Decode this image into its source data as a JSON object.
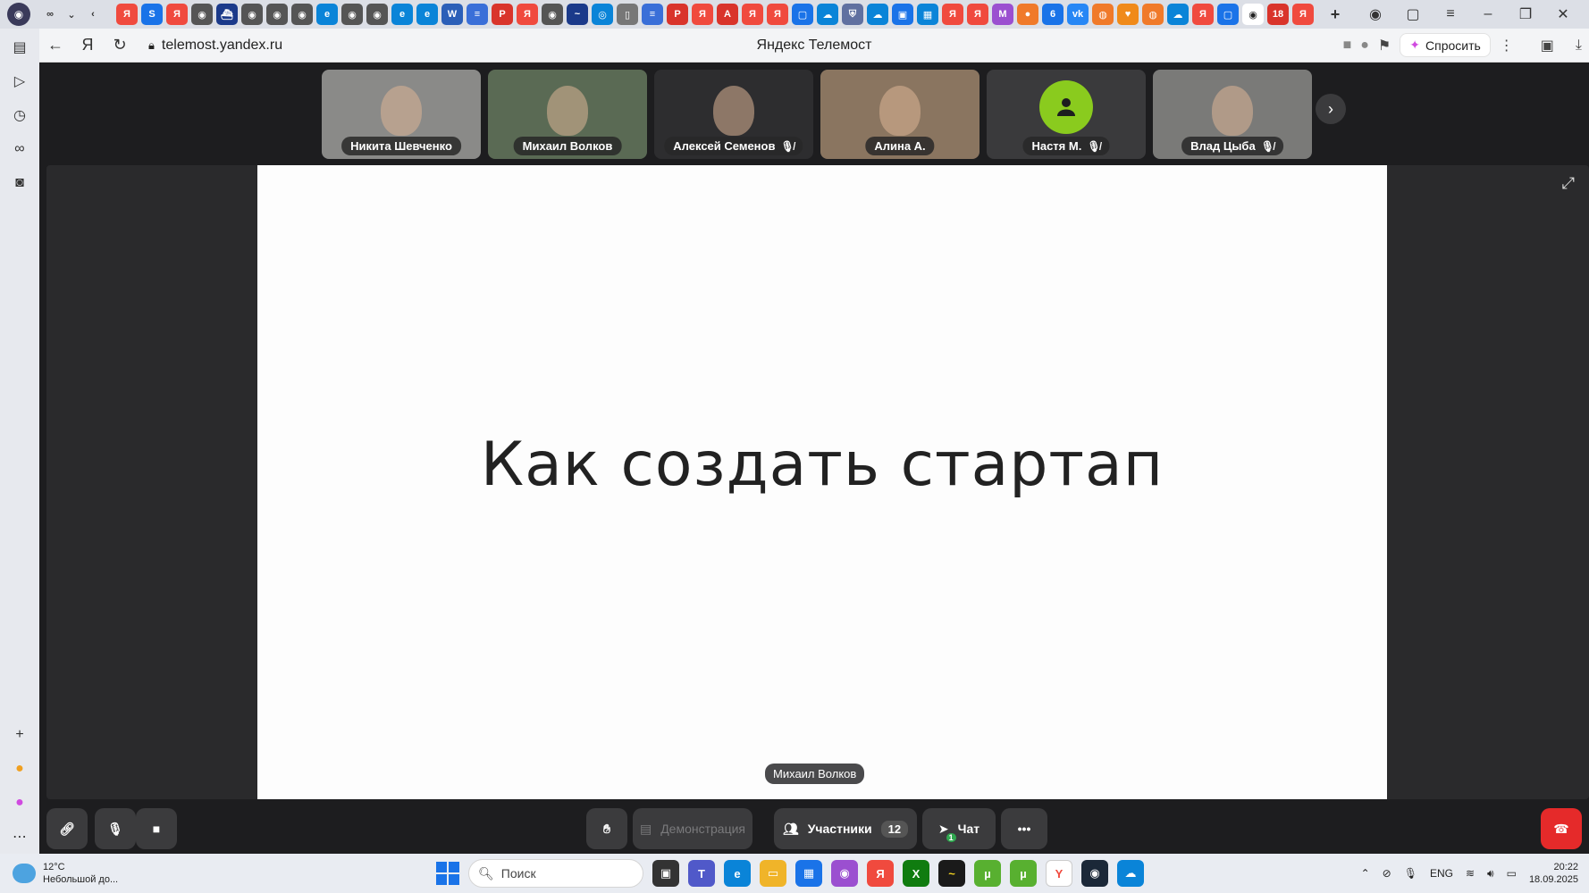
{
  "browser": {
    "url": "telemost.yandex.ru",
    "page_title": "Яндекс Телемост",
    "ask_label": "Спросить",
    "tab_icons": [
      {
        "name": "yandex-tab-icon",
        "color": "#f04a3e",
        "glyph": "Я"
      },
      {
        "name": "s-tab-icon",
        "color": "#1a73e8",
        "glyph": "S"
      },
      {
        "name": "yandex-tab-icon",
        "color": "#f04a3e",
        "glyph": "Я"
      },
      {
        "name": "aim-tab-icon",
        "color": "#555",
        "glyph": "◉"
      },
      {
        "name": "ship-tab-icon",
        "color": "#1b3a8a",
        "glyph": "⛴"
      },
      {
        "name": "aim-tab-icon",
        "color": "#555",
        "glyph": "◉"
      },
      {
        "name": "aim-tab-icon",
        "color": "#555",
        "glyph": "◉"
      },
      {
        "name": "aim-tab-icon",
        "color": "#555",
        "glyph": "◉"
      },
      {
        "name": "edge-tab-icon",
        "color": "#0a84d8",
        "glyph": "e"
      },
      {
        "name": "aim-tab-icon",
        "color": "#555",
        "glyph": "◉"
      },
      {
        "name": "aim-tab-icon",
        "color": "#555",
        "glyph": "◉"
      },
      {
        "name": "edge-tab-icon",
        "color": "#0a84d8",
        "glyph": "e"
      },
      {
        "name": "edge-tab-icon",
        "color": "#0a84d8",
        "glyph": "e"
      },
      {
        "name": "word-tab-icon",
        "color": "#2b5fb8",
        "glyph": "W"
      },
      {
        "name": "docs-tab-icon",
        "color": "#3a6fd8",
        "glyph": "≡"
      },
      {
        "name": "pdf-tab-icon",
        "color": "#d9342b",
        "glyph": "P"
      },
      {
        "name": "yandex-tab-icon",
        "color": "#f04a3e",
        "glyph": "Я"
      },
      {
        "name": "aim-tab-icon",
        "color": "#555",
        "glyph": "◉"
      },
      {
        "name": "bird-tab-icon",
        "color": "#1b3a8a",
        "glyph": "~"
      },
      {
        "name": "net-tab-icon",
        "color": "#0a84d8",
        "glyph": "◎"
      },
      {
        "name": "file-tab-icon",
        "color": "#777",
        "glyph": "▯"
      },
      {
        "name": "docs-tab-icon",
        "color": "#3a6fd8",
        "glyph": "≡"
      },
      {
        "name": "pdf-tab-icon",
        "color": "#d9342b",
        "glyph": "P"
      },
      {
        "name": "yandex-tab-icon",
        "color": "#f04a3e",
        "glyph": "Я"
      },
      {
        "name": "acrobat-tab-icon",
        "color": "#d9342b",
        "glyph": "A"
      },
      {
        "name": "yandex-tab-icon",
        "color": "#f04a3e",
        "glyph": "Я"
      },
      {
        "name": "yandex-tab-icon",
        "color": "#f04a3e",
        "glyph": "Я"
      },
      {
        "name": "chat-tab-icon",
        "color": "#1a73e8",
        "glyph": "▢"
      },
      {
        "name": "cloud-tab-icon",
        "color": "#0a84d8",
        "glyph": "☁"
      },
      {
        "name": "shield-tab-icon",
        "color": "#6070a0",
        "glyph": "⛨"
      },
      {
        "name": "cloud-tab-icon",
        "color": "#0a84d8",
        "glyph": "☁"
      },
      {
        "name": "store-tab-icon",
        "color": "#1a73e8",
        "glyph": "▣"
      },
      {
        "name": "calendar-tab-icon",
        "color": "#0a84d8",
        "glyph": "▦"
      },
      {
        "name": "yandex-tab-icon",
        "color": "#f04a3e",
        "glyph": "Я"
      },
      {
        "name": "yandex-tab-icon",
        "color": "#f04a3e",
        "glyph": "Я"
      },
      {
        "name": "market-tab-icon",
        "color": "#9b4fd0",
        "glyph": "M"
      },
      {
        "name": "orange-tab-icon",
        "color": "#f07a2a",
        "glyph": "●"
      },
      {
        "name": "six-tab-icon",
        "color": "#1a73e8",
        "glyph": "6"
      },
      {
        "name": "vk-tab-icon",
        "color": "#2787f5",
        "glyph": "vk"
      },
      {
        "name": "ok-tab-icon",
        "color": "#f07a2a",
        "glyph": "◍"
      },
      {
        "name": "heart-tab-icon",
        "color": "#f08a1a",
        "glyph": "♥"
      },
      {
        "name": "ok-tab-icon",
        "color": "#f07a2a",
        "glyph": "◍"
      },
      {
        "name": "cloud-tab-icon",
        "color": "#0a84d8",
        "glyph": "☁"
      },
      {
        "name": "yandex-tab-icon",
        "color": "#f04a3e",
        "glyph": "Я"
      },
      {
        "name": "chat-tab-icon",
        "color": "#1a73e8",
        "glyph": "▢"
      },
      {
        "name": "telemost-tab-icon",
        "color": "#222",
        "glyph": "◉",
        "active": true
      },
      {
        "name": "eighteen-tab-icon",
        "color": "#d9342b",
        "glyph": "18"
      },
      {
        "name": "yandex-tab-icon",
        "color": "#f04a3e",
        "glyph": "Я"
      }
    ]
  },
  "participants": [
    {
      "name": "Никита Шевченко",
      "muted": false,
      "bg": "#8a8a88"
    },
    {
      "name": "Михаил Волков",
      "muted": false,
      "bg": "#5a6a54"
    },
    {
      "name": "Алексей Семенов",
      "muted": true,
      "bg": "#2d2d2f"
    },
    {
      "name": "Алина А.",
      "muted": false,
      "bg": "#8a7560"
    },
    {
      "name": "Настя М.",
      "muted": true,
      "bg": "#3a3a3c",
      "avatar": true
    },
    {
      "name": "Влад Цыба",
      "muted": true,
      "bg": "#7a7a78"
    }
  ],
  "slide": {
    "title": "Как создать стартап"
  },
  "speaker_label": "Михаил Волков",
  "controls": {
    "screen_share": "Демонстрация",
    "participants": "Участники",
    "participants_count": "12",
    "chat": "Чат",
    "chat_badge": "1"
  },
  "taskbar": {
    "temperature": "12°C",
    "weather_desc": "Небольшой до...",
    "search_placeholder": "Поиск",
    "lang": "ENG",
    "time": "20:22",
    "date": "18.09.2025"
  }
}
